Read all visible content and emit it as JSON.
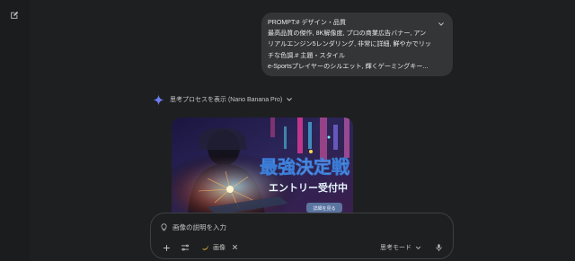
{
  "sidebar": {
    "new_chat_icon": "edit-square-icon"
  },
  "prompt": {
    "lines": [
      "PROMPT:# デザイン・品質",
      "最高品質の傑作, 8K解像度, プロの商業広告バナー, アンリアルエンジン5レンダリング, 非常に詳細, 鮮やかでリッチな色調.# 主題・スタイル",
      "e-Sportsプレイヤーのシルエット, 輝くゲーミングキー..."
    ],
    "expand_icon": "chevron-down-icon"
  },
  "response": {
    "thinking_label": "思考プロセスを表示 (Nano Banana Pro)",
    "spark_icon": "gemini-spark-icon"
  },
  "image": {
    "headline": "最強決定戦",
    "subline": "エントリー受付中",
    "button_text": "詳細を見る"
  },
  "composer": {
    "placeholder": "画像の説明を入力",
    "chip_label": "画像",
    "mode_label": "思考モード",
    "colors": {
      "border": "#3c4043",
      "chip_icon": "#f6c445"
    }
  }
}
